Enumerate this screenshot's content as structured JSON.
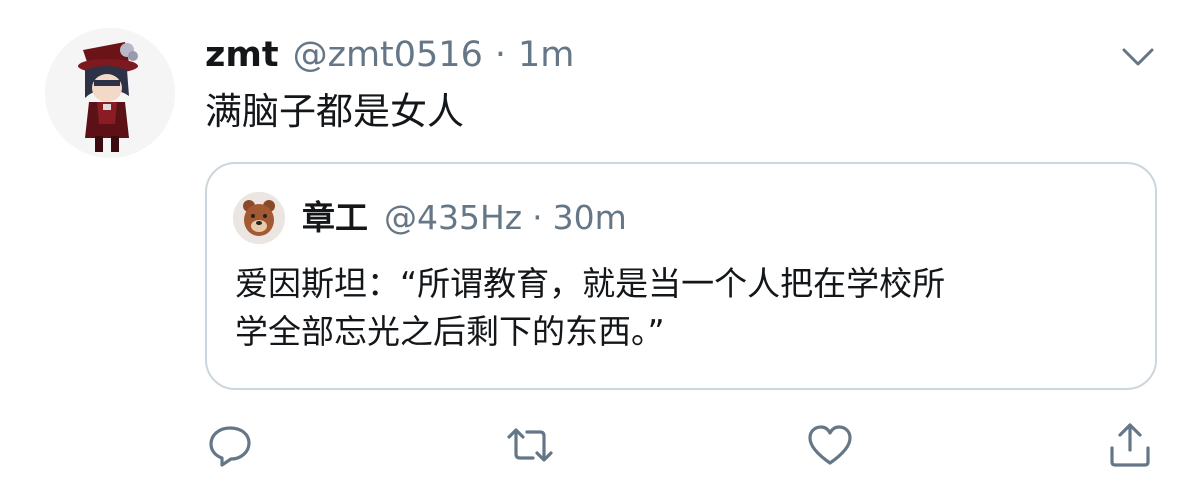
{
  "tweet": {
    "user": {
      "name": "zmt",
      "handle": "@zmt0516",
      "avatar_icon": "anime-character-avatar"
    },
    "separator": "·",
    "time": "1m",
    "text": "满脑子都是女人"
  },
  "quoted_tweet": {
    "user": {
      "name": "章工",
      "handle": "@435Hz",
      "avatar_icon": "bear-avatar"
    },
    "separator": "·",
    "time": "30m",
    "text_line1": "爱因斯坦：“所谓教育，就是当一个人把在学校所",
    "text_line2": "学全部忘光之后剩下的东西。”"
  },
  "actions": {
    "reply_icon": "reply-icon",
    "retweet_icon": "retweet-icon",
    "like_icon": "heart-icon",
    "share_icon": "share-icon"
  },
  "colors": {
    "text_primary": "#14171a",
    "text_secondary": "#657786",
    "border": "#ccd6dd"
  }
}
